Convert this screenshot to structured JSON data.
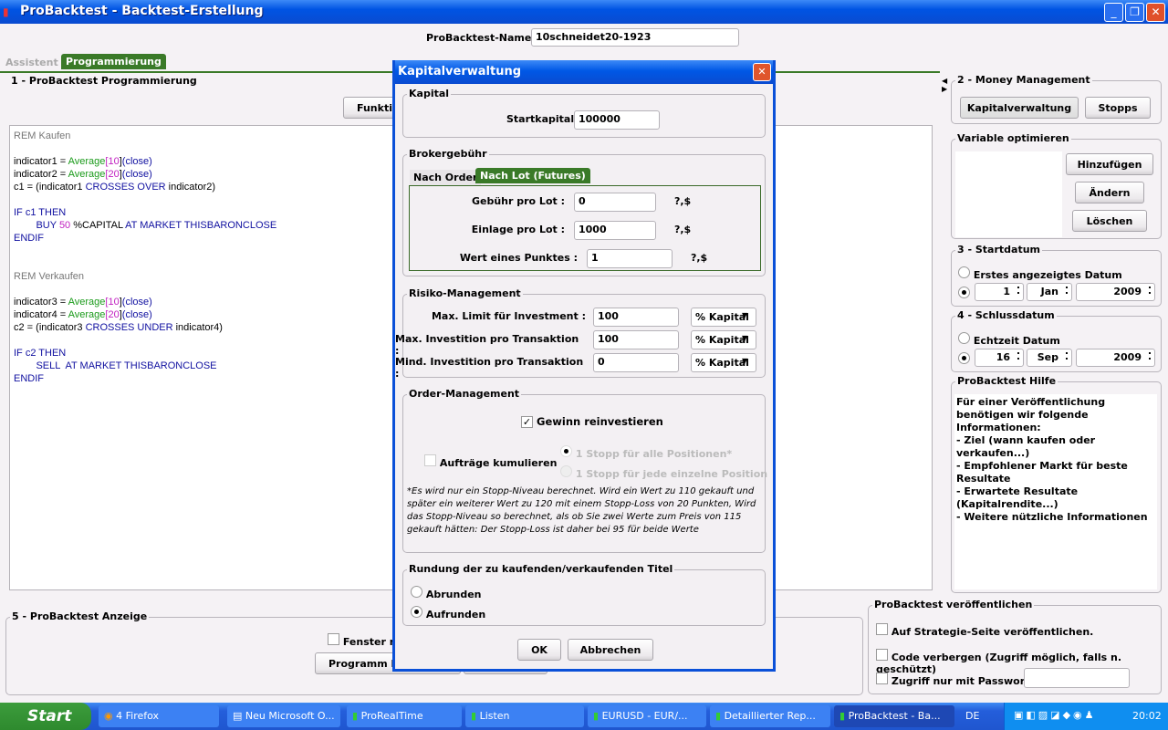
{
  "window": {
    "title": "ProBacktest - Backtest-Erstellung",
    "name_label": "ProBacktest-Name :",
    "name_value": "10schneidet20-1923"
  },
  "tabs": [
    {
      "label": "Assistent",
      "active": false
    },
    {
      "label": "Programmierung",
      "active": true
    }
  ],
  "programming": {
    "title": "1 - ProBacktest Programmierung",
    "button": "Funktio",
    "code": [
      [
        [
          "REM Kaufen",
          "gray"
        ]
      ],
      [],
      [
        [
          "indicator1 = ",
          ""
        ],
        [
          "Average",
          "green"
        ],
        [
          "[",
          "mag"
        ],
        [
          "10",
          "mag"
        ],
        [
          "]",
          ""
        ],
        [
          "(close)",
          "blue"
        ]
      ],
      [
        [
          "indicator2 = ",
          ""
        ],
        [
          "Average",
          "green"
        ],
        [
          "[",
          "mag"
        ],
        [
          "20",
          "mag"
        ],
        [
          "]",
          ""
        ],
        [
          "(close)",
          "blue"
        ]
      ],
      [
        [
          "c1 = (indicator1 ",
          ""
        ],
        [
          "CROSSES OVER",
          "blue"
        ],
        [
          " indicator2)",
          ""
        ]
      ],
      [],
      [
        [
          "IF c1 THEN",
          "blue"
        ]
      ],
      [
        [
          "        BUY ",
          "blue"
        ],
        [
          "50",
          "mag"
        ],
        [
          " %CAPITAL ",
          ""
        ],
        [
          "AT MARKET THISBARONCLOSE",
          "blue"
        ]
      ],
      [
        [
          "ENDIF",
          "blue"
        ]
      ],
      [],
      [],
      [
        [
          "REM Verkaufen",
          "gray"
        ]
      ],
      [],
      [
        [
          "indicator3 = ",
          ""
        ],
        [
          "Average",
          "green"
        ],
        [
          "[",
          "mag"
        ],
        [
          "10",
          "mag"
        ],
        [
          "]",
          ""
        ],
        [
          "(close)",
          "blue"
        ]
      ],
      [
        [
          "indicator4 = ",
          ""
        ],
        [
          "Average",
          "green"
        ],
        [
          "[",
          "mag"
        ],
        [
          "20",
          "mag"
        ],
        [
          "]",
          ""
        ],
        [
          "(close)",
          "blue"
        ]
      ],
      [
        [
          "c2 = (indicator3 ",
          ""
        ],
        [
          "CROSSES UNDER",
          "blue"
        ],
        [
          " indicator4)",
          ""
        ]
      ],
      [],
      [
        [
          "IF c2 THEN",
          "blue"
        ]
      ],
      [
        [
          "        SELL  AT MARKET THISBARONCLOSE",
          "blue"
        ]
      ],
      [
        [
          "ENDIF",
          "blue"
        ]
      ]
    ]
  },
  "display": {
    "title": "5 - ProBacktest Anzeige",
    "checkbox": "Fenster na",
    "button": "Programm b"
  },
  "money": {
    "title": "2 - Money Management",
    "kapital_button": "Kapitalverwaltung",
    "stopps_button": "Stopps"
  },
  "optimize": {
    "title": "Variable optimieren",
    "add": "Hinzufügen",
    "edit": "Ändern",
    "delete": "Löschen"
  },
  "startdate": {
    "title": "3 - Startdatum",
    "option1": "Erstes angezeigtes Datum",
    "day": "1",
    "month": "Jan",
    "year": "2009"
  },
  "enddate": {
    "title": "4 - Schlussdatum",
    "option1": "Echtzeit Datum",
    "day": "16",
    "month": "Sep",
    "year": "2009"
  },
  "help": {
    "title": "ProBacktest Hilfe",
    "text": "Für einer Veröffentlichung benötigen wir folgende Informationen:\n- Ziel (wann kaufen oder verkaufen...)\n- Empfohlener Markt für beste Resultate\n- Erwartete Resultate (Kapitalrendite...)\n- Weitere nützliche Informationen"
  },
  "publish": {
    "title": "ProBacktest veröffentlichen",
    "opt1": "Auf Strategie-Seite veröffentlichen.",
    "opt2": "Code verbergen (Zugriff möglich, falls n. geschützt)",
    "opt3": "Zugriff nur mit Passwort :",
    "password": ""
  },
  "dialog": {
    "title": "Kapitalverwaltung",
    "kapital": {
      "title": "Kapital",
      "label": "Startkapital :",
      "value": "100000"
    },
    "broker": {
      "title": "Brokergebühr",
      "tab1": "Nach Order",
      "tab2": "Nach Lot (Futures)",
      "rows": [
        {
          "label": "Gebühr pro Lot :",
          "value": "0",
          "unit": "?,$"
        },
        {
          "label": "Einlage pro Lot :",
          "value": "1000",
          "unit": "?,$"
        },
        {
          "label": "Wert eines Punktes :",
          "value": "1",
          "unit": "?,$"
        }
      ]
    },
    "risk": {
      "title": "Risiko-Management",
      "rows": [
        {
          "label": "Max. Limit für Investment :",
          "value": "100",
          "unit": "% Kapital"
        },
        {
          "label": "Max. Investition pro Transaktion :",
          "value": "100",
          "unit": "% Kapital"
        },
        {
          "label": "Mind. Investition pro Transaktion :",
          "value": "0",
          "unit": "% Kapital"
        }
      ]
    },
    "order": {
      "title": "Order-Management",
      "reinvest": "Gewinn reinvestieren",
      "reinvest_checked": true,
      "cumulate": "Aufträge kumulieren",
      "cumulate_checked": false,
      "stop1": "1 Stopp für alle Positionen*",
      "stop2": "1 Stopp für jede einzelne Position",
      "note": "*Es wird nur ein Stopp-Niveau berechnet. Wird ein Wert zu 110 gekauft und später ein weiterer Wert zu 120 mit einem Stopp-Loss von 20 Punkten, Wird das Stopp-Niveau so berechnet, als ob Sie zwei Werte zum Preis von 115 gekauft hätten: Der Stopp-Loss ist daher bei 95 für beide Werte"
    },
    "rounding": {
      "title": "Rundung der zu kaufenden/verkaufenden Titel",
      "opt1": "Abrunden",
      "opt2": "Aufrunden",
      "selected": "Aufrunden"
    },
    "ok": "OK",
    "cancel": "Abbrechen"
  },
  "taskbar": {
    "start": "Start",
    "items": [
      "4 Firefox",
      "Neu Microsoft O...",
      "ProRealTime",
      "Listen",
      "EURUSD - EUR/...",
      "Detaillierter Rep...",
      "ProBacktest - Ba..."
    ],
    "lang": "DE",
    "clock": "20:02"
  }
}
